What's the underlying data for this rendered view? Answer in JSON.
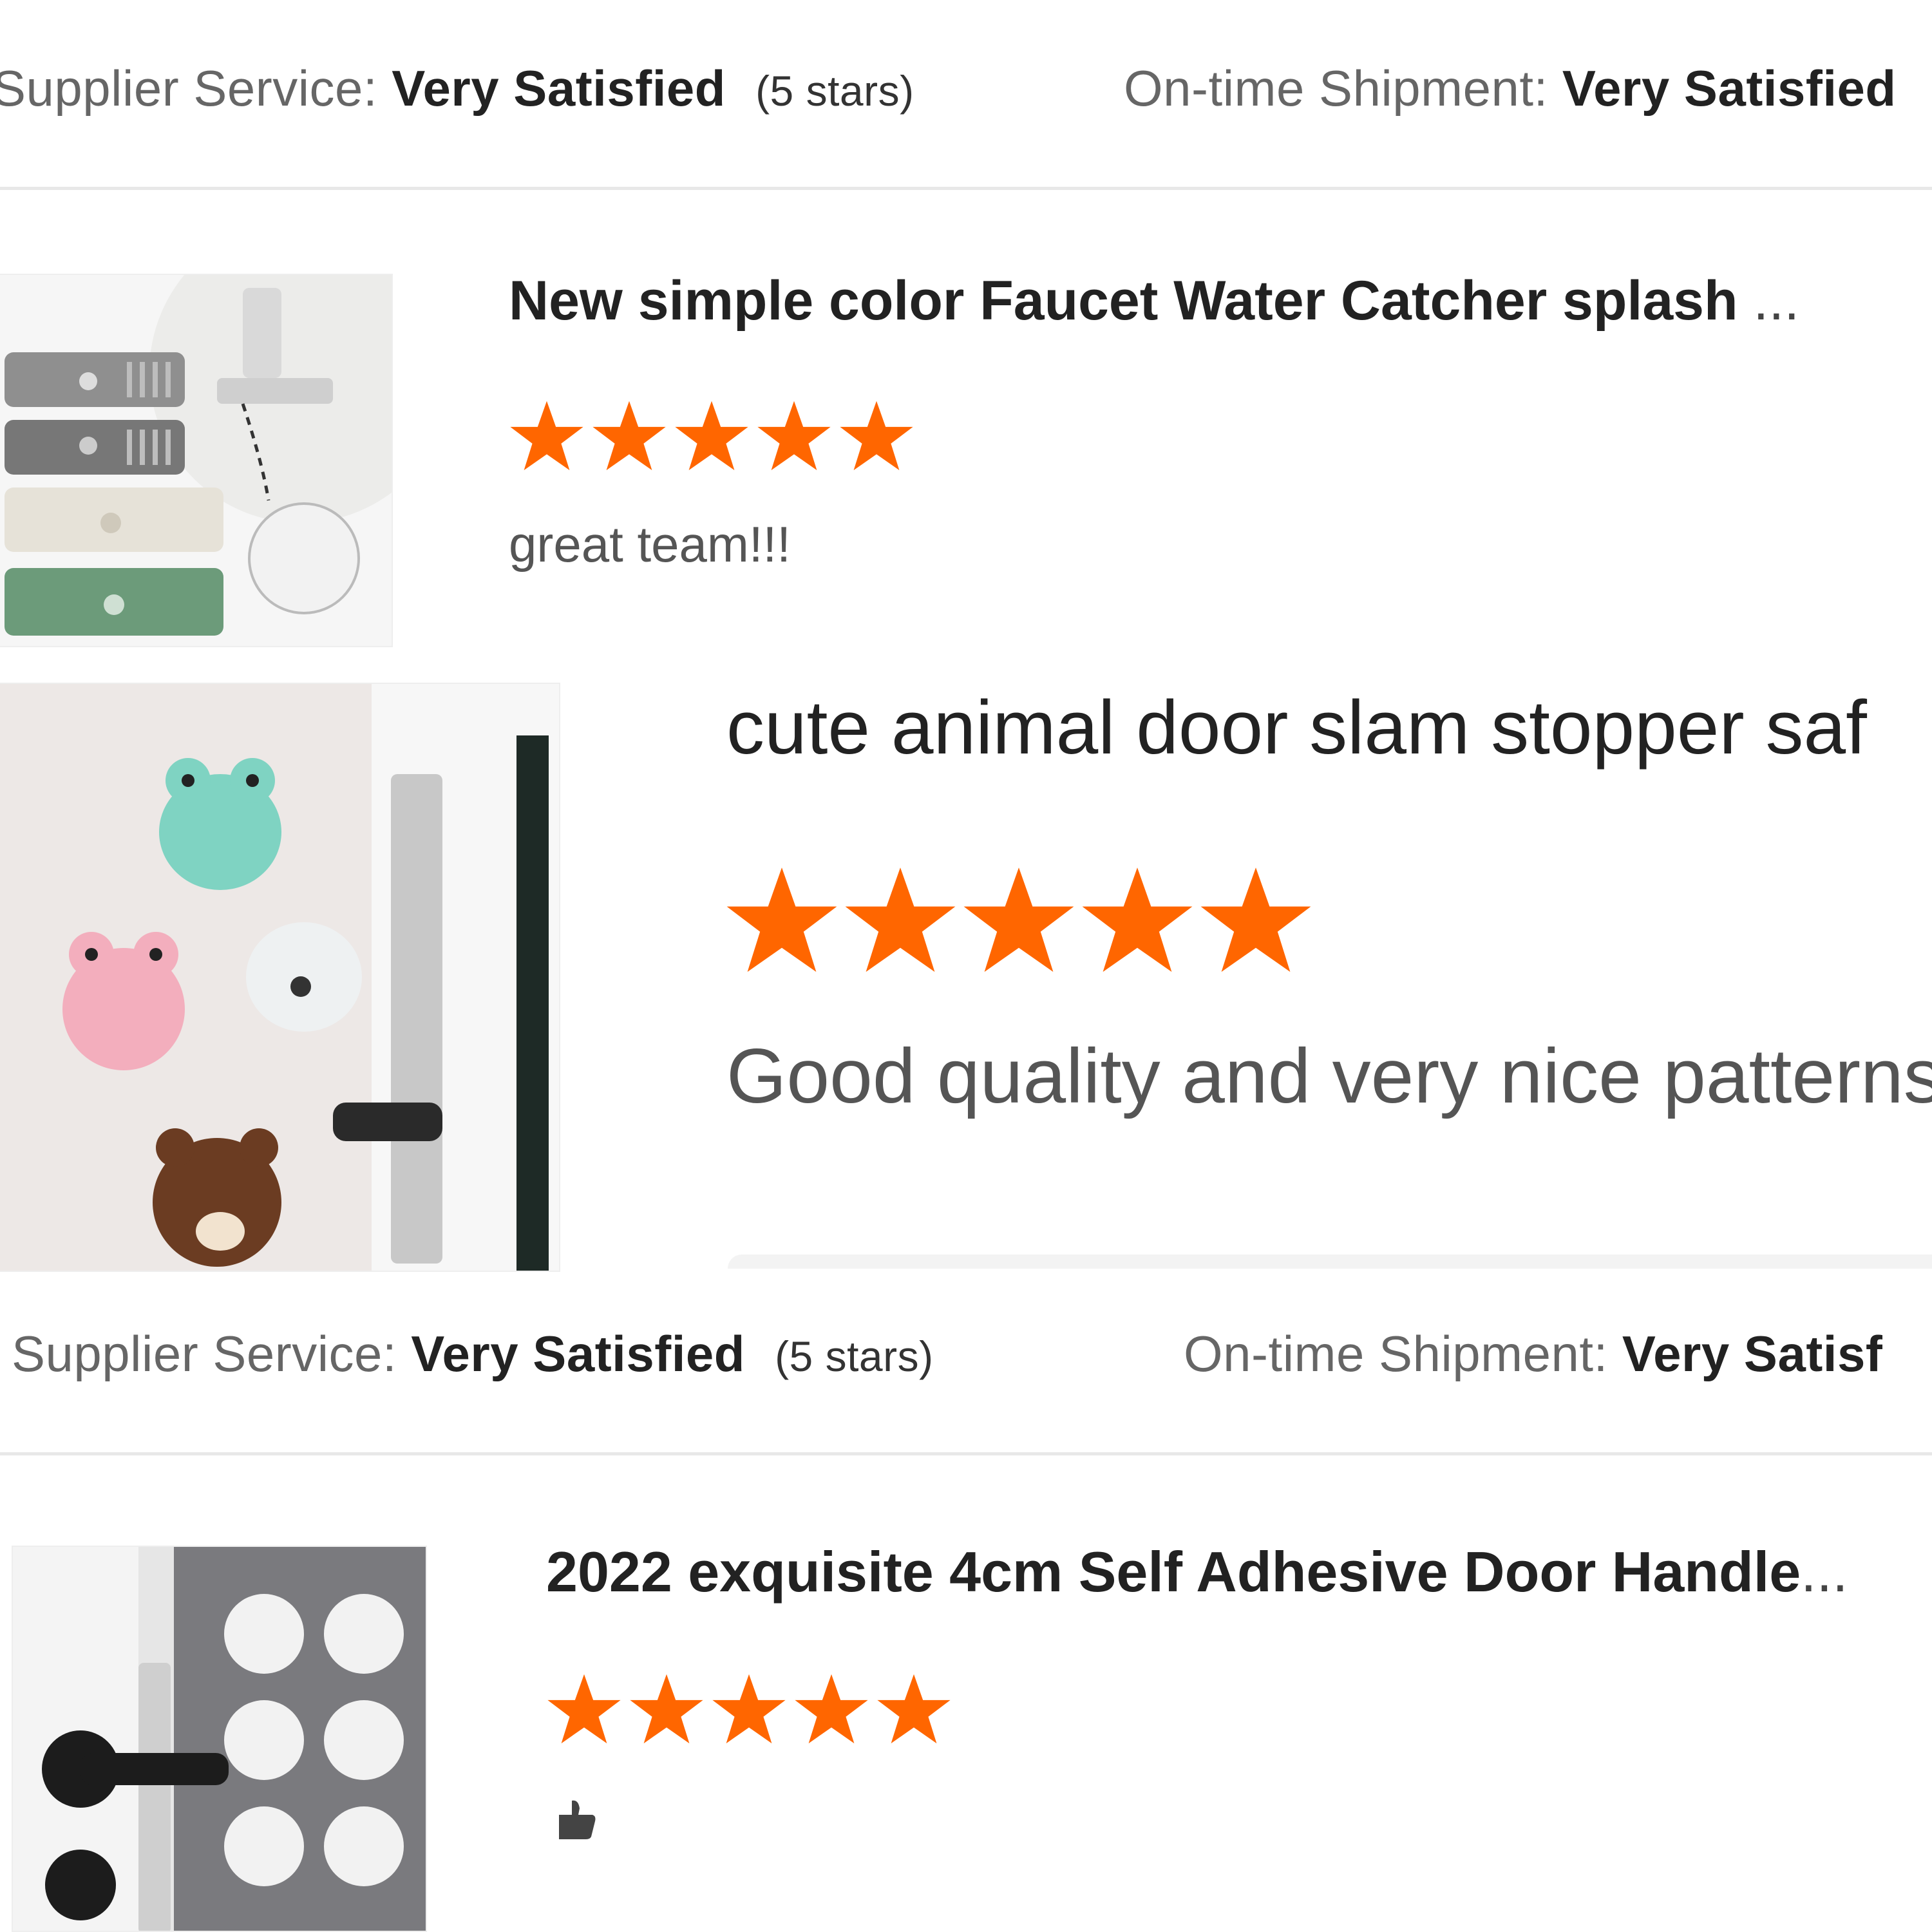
{
  "colors": {
    "star": "#ff6600",
    "label": "#666666",
    "value": "#222222",
    "divider": "#e8e8e8"
  },
  "top_rating": {
    "supplier_label": "Supplier Service:",
    "supplier_value": "Very Satisfied",
    "supplier_note": "(5 stars)",
    "shipment_label": "On-time Shipment:",
    "shipment_value": "Very Satisfied"
  },
  "reviews": [
    {
      "title": "New simple color Faucet Water Catcher splash",
      "ellipsis": "...",
      "stars": 5,
      "comment": "great team!!!",
      "image_icon": "faucet-mat-product-image"
    },
    {
      "title": "cute animal door slam stopper saf",
      "stars": 5,
      "comment": "Good quality and very nice patterns",
      "image_icon": "animal-door-stopper-product-image"
    },
    {
      "title": "2022 exquisite 4cm Self Adhesive Door Handle",
      "ellipsis": "...",
      "stars": 5,
      "comment_icon": "thumbs-up-icon",
      "image_icon": "door-bumper-product-image"
    }
  ],
  "mid_rating": {
    "supplier_label": "Supplier Service:",
    "supplier_value": "Very Satisfied",
    "supplier_note": "(5 stars)",
    "shipment_label": "On-time Shipment:",
    "shipment_value": "Very Satisf"
  }
}
